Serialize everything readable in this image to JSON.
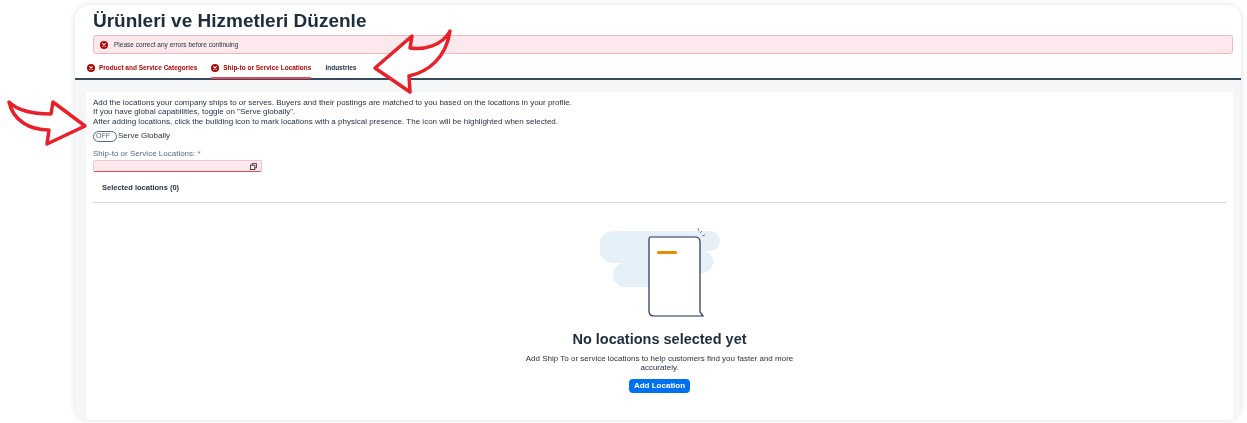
{
  "page": {
    "title": "Ürünleri ve Hizmetleri Düzenle"
  },
  "error_banner": {
    "message": "Please correct any errors before continuing"
  },
  "tabs": [
    {
      "label": "Product and Service Categories",
      "selected": false,
      "error": true
    },
    {
      "label": "Ship-to or Service Locations",
      "selected": true,
      "error": true
    },
    {
      "label": "Industries",
      "selected": false,
      "error": false
    }
  ],
  "intro": [
    "Add the locations your company ships to or serves. Buyers and their postings are matched to you based on the locations in your profile.",
    "If you have global capabilities, toggle on \"Serve globally\".",
    "After adding locations, click the building icon to mark locations with a physical presence. The icon will be highlighted when selected."
  ],
  "serve_globally": {
    "switch_text": "OFF",
    "label": "Serve Globally",
    "on": false
  },
  "locations_field": {
    "label": "Ship-to or Service Locations:",
    "required_mark": "*",
    "invalid": true
  },
  "selected_locations": {
    "heading": "Selected locations (0)"
  },
  "empty_state": {
    "title": "No locations selected yet",
    "message": "Add Ship To or service locations to help customers find you faster and more accurately.",
    "button": "Add Location"
  }
}
